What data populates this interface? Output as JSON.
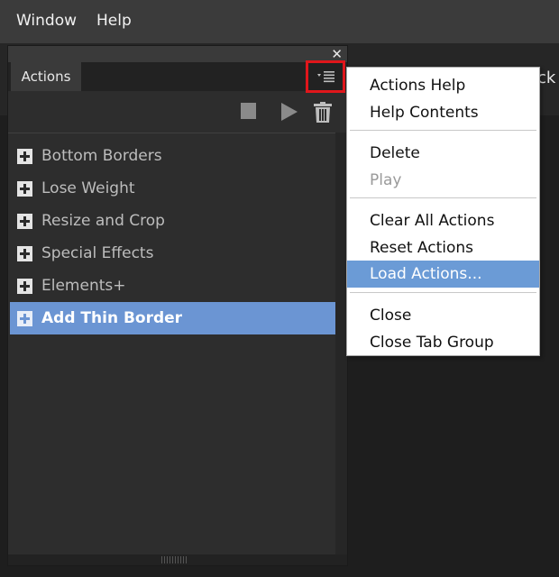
{
  "menubar": {
    "items": [
      "Window",
      "Help"
    ]
  },
  "background": {
    "partial_text": "ck"
  },
  "panel": {
    "close_glyph": "✕",
    "tab_label": "Actions",
    "toolbar_icons": [
      "stop-icon",
      "play-icon",
      "trash-icon"
    ],
    "items": [
      {
        "label": "Bottom Borders",
        "selected": false
      },
      {
        "label": "Lose Weight",
        "selected": false
      },
      {
        "label": "Resize and Crop",
        "selected": false
      },
      {
        "label": "Special Effects",
        "selected": false
      },
      {
        "label": "Elements+",
        "selected": false
      },
      {
        "label": "Add Thin Border",
        "selected": true
      }
    ]
  },
  "flyout_menu": {
    "groups": [
      [
        "Actions Help",
        "Help Contents"
      ],
      [
        "Delete",
        "Play"
      ],
      [
        "Clear All Actions",
        "Reset Actions",
        "Load Actions..."
      ],
      [
        "Close",
        "Close Tab Group"
      ]
    ],
    "disabled": [
      "Play"
    ],
    "highlighted": "Load Actions..."
  },
  "colors": {
    "selection": "#6b95d3",
    "menu_highlight": "#6b9bd6",
    "callout_border": "#e0161b"
  }
}
